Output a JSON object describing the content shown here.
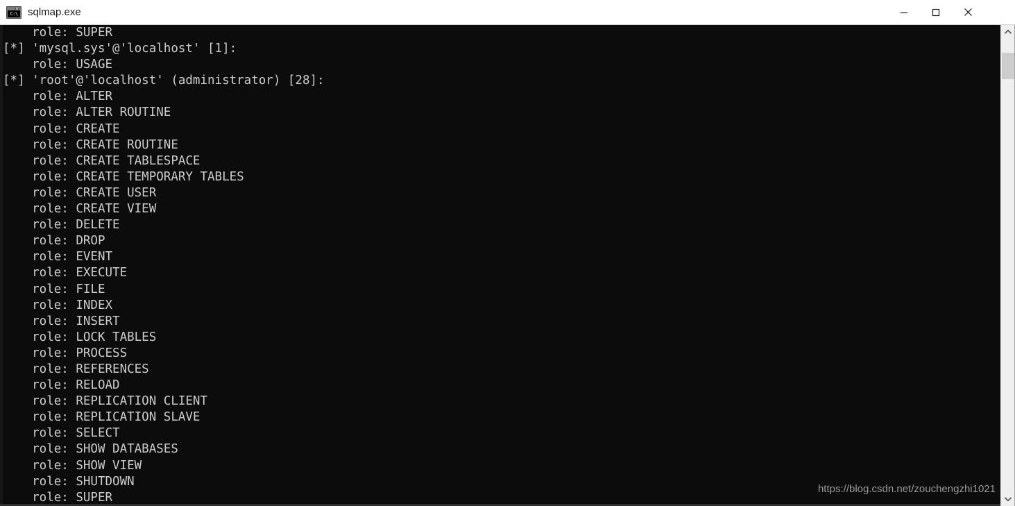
{
  "window": {
    "title": "sqlmap.exe",
    "icon": "cmd-console-icon",
    "icon_text": "C:\\",
    "background_color": "#0c0c0c",
    "text_color": "#cccccc",
    "controls": {
      "minimize": "Minimize",
      "maximize": "Maximize",
      "close": "Close"
    }
  },
  "terminal": {
    "lines": [
      "    role: SUPER",
      "[*] 'mysql.sys'@'localhost' [1]:",
      "    role: USAGE",
      "[*] 'root'@'localhost' (administrator) [28]:",
      "    role: ALTER",
      "    role: ALTER ROUTINE",
      "    role: CREATE",
      "    role: CREATE ROUTINE",
      "    role: CREATE TABLESPACE",
      "    role: CREATE TEMPORARY TABLES",
      "    role: CREATE USER",
      "    role: CREATE VIEW",
      "    role: DELETE",
      "    role: DROP",
      "    role: EVENT",
      "    role: EXECUTE",
      "    role: FILE",
      "    role: INDEX",
      "    role: INSERT",
      "    role: LOCK TABLES",
      "    role: PROCESS",
      "    role: REFERENCES",
      "    role: RELOAD",
      "    role: REPLICATION CLIENT",
      "    role: REPLICATION SLAVE",
      "    role: SELECT",
      "    role: SHOW DATABASES",
      "    role: SHOW VIEW",
      "    role: SHUTDOWN",
      "    role: SUPER"
    ]
  },
  "watermark": {
    "text": "https://blog.csdn.net/zouchengzhi1021"
  },
  "scrollbar": {
    "up_arrow": "scroll-up-arrow",
    "down_arrow": "scroll-down-arrow",
    "thumb": "scroll-thumb"
  }
}
